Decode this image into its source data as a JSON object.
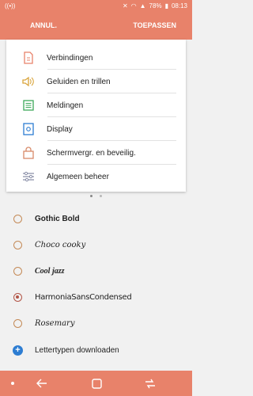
{
  "status": {
    "battery": "78%",
    "time": "08:13"
  },
  "header": {
    "cancel": "ANNUL.",
    "apply": "TOEPASSEN"
  },
  "preview": {
    "items": [
      {
        "label": "Verbindingen",
        "icon": "link-icon"
      },
      {
        "label": "Geluiden en trillen",
        "icon": "speaker-icon"
      },
      {
        "label": "Meldingen",
        "icon": "notifications-icon"
      },
      {
        "label": "Display",
        "icon": "display-icon"
      },
      {
        "label": "Schermvergr. en beveilig.",
        "icon": "lock-icon"
      },
      {
        "label": "Algemeen beheer",
        "icon": "sliders-icon"
      }
    ],
    "page": 1,
    "page_count": 2
  },
  "fonts": {
    "options": [
      {
        "label": "Gothic Bold",
        "selected": false
      },
      {
        "label": "Choco cooky",
        "selected": false
      },
      {
        "label": "Cool jazz",
        "selected": false
      },
      {
        "label": "HarmoniaSansCondensed",
        "selected": true
      },
      {
        "label": "Rosemary",
        "selected": false
      }
    ],
    "download_label": "Lettertypen downloaden"
  },
  "colors": {
    "accent": "#e8826a",
    "radio": "#c48a57",
    "radio_selected": "#b25547",
    "download": "#2d7dd2"
  }
}
